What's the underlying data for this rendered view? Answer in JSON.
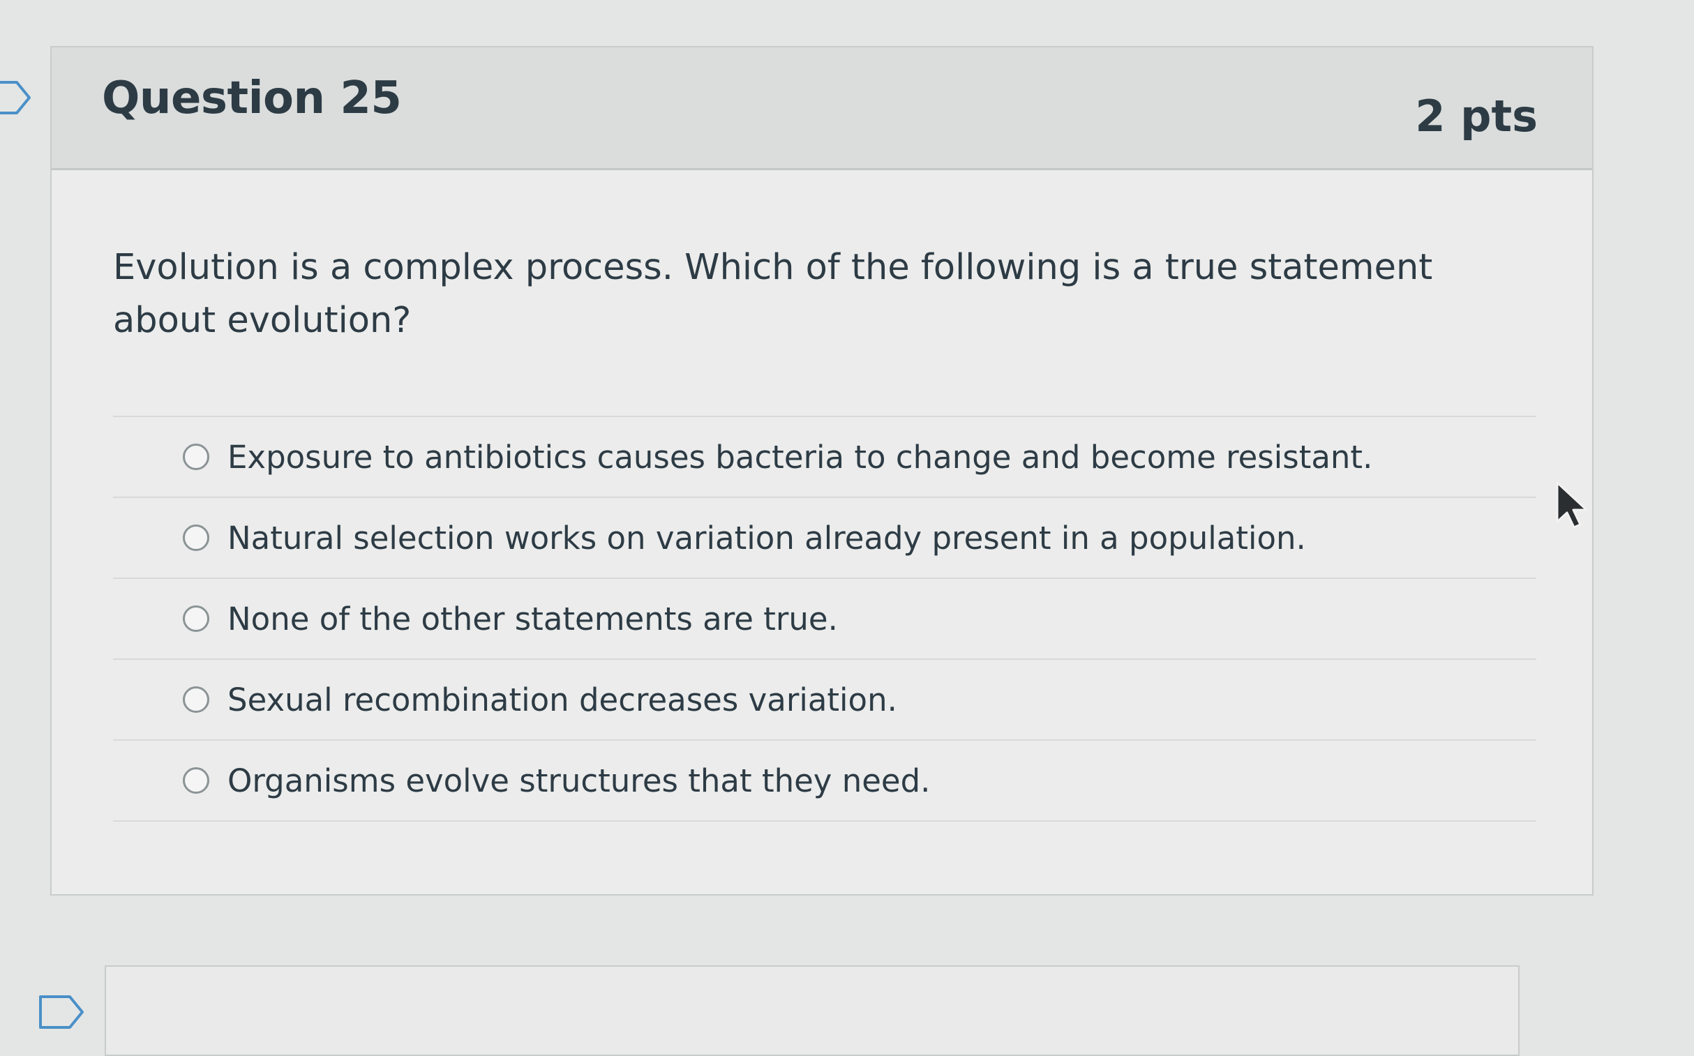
{
  "question": {
    "title": "Question 25",
    "points": "2 pts",
    "text": "Evolution is a complex process. Which of the following is a true statement about evolution?",
    "answers": [
      {
        "label": "Exposure to antibiotics causes bacteria to change and become resistant.",
        "selected": false
      },
      {
        "label": "Natural selection works on variation already present in a population.",
        "selected": false
      },
      {
        "label": "None of the other statements are true.",
        "selected": false
      },
      {
        "label": "Sexual recombination decreases variation.",
        "selected": false
      },
      {
        "label": "Organisms evolve structures that they need.",
        "selected": false
      }
    ]
  },
  "icons": {
    "bookmark": "bookmark-flag-icon",
    "cursor": "mouse-pointer-icon",
    "radio": "radio-unselected-icon"
  },
  "colors": {
    "header_background": "#dadddc",
    "body_background": "#ebeceb",
    "text": "#2d3b45",
    "border": "#c8cccb"
  }
}
